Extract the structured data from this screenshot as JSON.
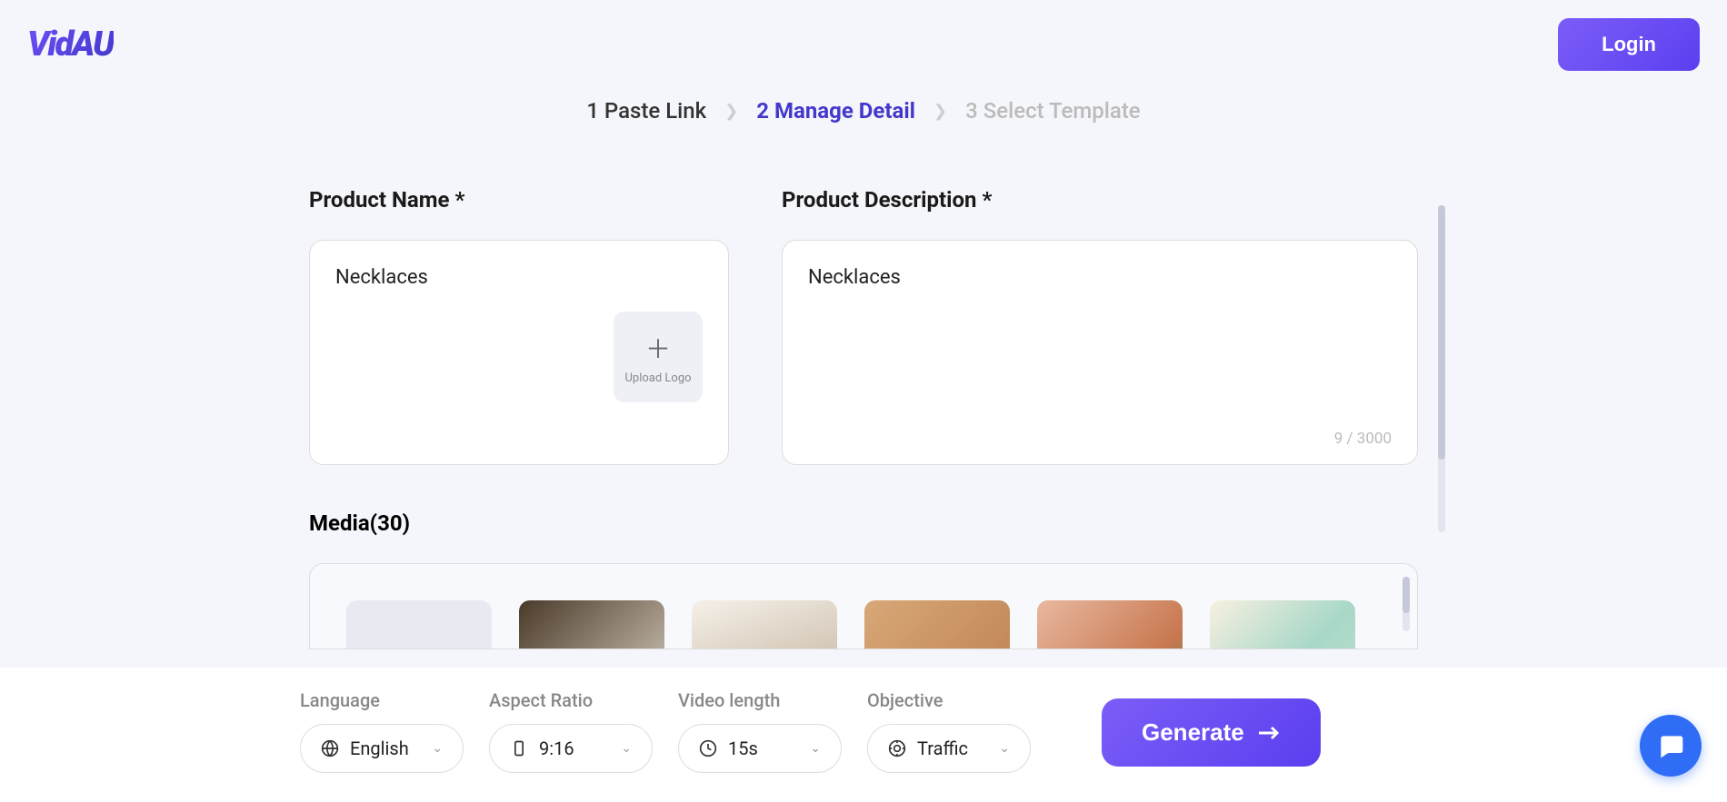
{
  "header": {
    "logo": "VidAU",
    "login_label": "Login"
  },
  "breadcrumb": {
    "step1": "1 Paste Link",
    "step2": "2 Manage Detail",
    "step3": "3 Select Template"
  },
  "form": {
    "product_name_label": "Product Name *",
    "product_name_value": "Necklaces",
    "upload_logo_label": "Upload Logo",
    "product_desc_label": "Product Description *",
    "product_desc_value": "Necklaces",
    "char_count": "9 / 3000",
    "media_label": "Media(30)"
  },
  "controls": {
    "language_label": "Language",
    "language_value": "English",
    "aspect_label": "Aspect Ratio",
    "aspect_value": "9:16",
    "length_label": "Video length",
    "length_value": "15s",
    "objective_label": "Objective",
    "objective_value": "Traffic",
    "generate_label": "Generate"
  }
}
